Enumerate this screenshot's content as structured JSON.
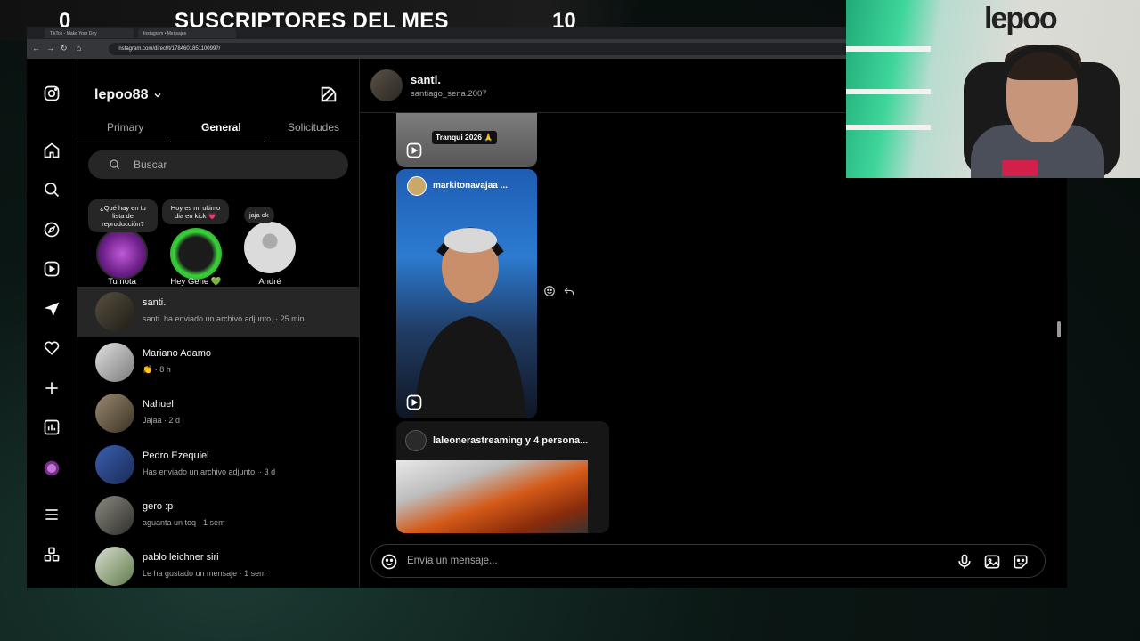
{
  "overlay": {
    "left_count": "0",
    "title": "SUSCRIPTORES DEL MES",
    "right_count": "10"
  },
  "browser": {
    "tabs": [
      "TikTok - Make Your Day",
      "Instagram • Mensajes"
    ],
    "url": "instagram.com/direct/t/178460185110099?/"
  },
  "rail_icons": [
    "instagram-icon",
    "home-icon",
    "search-icon",
    "explore-icon",
    "reels-icon",
    "messages-icon",
    "notifications-icon",
    "create-icon",
    "dashboard-icon",
    "profile-icon",
    "more-icon",
    "also-from-meta-icon"
  ],
  "inbox": {
    "username": "lepoo88",
    "tabs": [
      "Primary",
      "General",
      "Solicitudes"
    ],
    "active_tab": "General",
    "search_placeholder": "Buscar",
    "notes": [
      {
        "bubble": "¿Qué hay en tu lista de reproducción?",
        "label": "Tu nota"
      },
      {
        "bubble": "Hoy es mi ultimo dia en kick 💗",
        "label": "Hey Gene 💚"
      },
      {
        "bubble": "jaja ok",
        "label": "André"
      }
    ],
    "threads": [
      {
        "name": "santi.",
        "preview": "santi. ha enviado un archivo adjunto. · 25 min",
        "active": true
      },
      {
        "name": "Mariano Adamo",
        "preview": "👏 · 8 h"
      },
      {
        "name": "Nahuel",
        "preview": "Jajaa · 2 d"
      },
      {
        "name": "Pedro Ezequiel",
        "preview": "Has enviado un archivo adjunto. · 3 d"
      },
      {
        "name": "gero :p",
        "preview": "aguanta un toq · 1 sem"
      },
      {
        "name": "pablo leichner siri",
        "preview": "Le ha gustado un mensaje · 1 sem"
      }
    ]
  },
  "chat": {
    "name": "santi.",
    "handle": "santiago_sena.2007",
    "reel_top_caption": "Tranqui 2026 🙏",
    "reel_author": "markitonavajaa ...",
    "shared_post_title": "laleonerastreaming y 4 persona...",
    "composer_placeholder": "Envía un mensaje..."
  }
}
